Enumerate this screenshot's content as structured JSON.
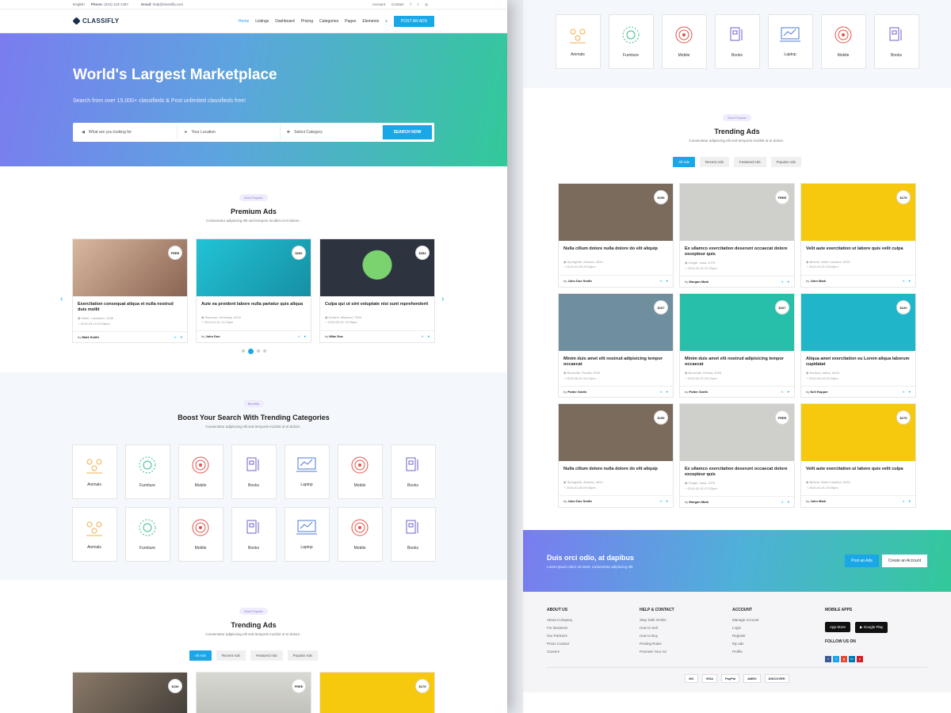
{
  "topbar": {
    "language": "English",
    "phone_label": "Phone:",
    "phone": "(024) 123-1457",
    "email_label": "Email:",
    "email": "help@classifly.com",
    "account": "Account",
    "contact": "Contact"
  },
  "nav": {
    "logo": "CLASSIFLY",
    "items": [
      "Home",
      "Listings",
      "Dashboard",
      "Pricing",
      "Categories",
      "Pages",
      "Elements"
    ],
    "post_button": "POST AN ADS"
  },
  "hero": {
    "title": "World's Largest Marketplace",
    "subtitle": "Search from over 15,000+ classifieds & Post unlimited classifieds free!",
    "search_placeholder": "What are you looking for",
    "location_placeholder": "Your Location",
    "category_select": "Select Category",
    "search_button": "SEARCH NOW"
  },
  "premium": {
    "pill": "Most Popular",
    "title": "Premium Ads",
    "subtitle": "Consectetur adipiscing elit sed tempore incidint ut et dolore .",
    "cards": [
      {
        "price": "FREE",
        "title": "Exercitation consequat aliqua et nulla nostrud duis mollit",
        "location": "Vielle, Louisiana, 1258",
        "date": "2019-05-19 03:08pm",
        "author": "Mark Smith",
        "color": "#b78a72"
      },
      {
        "price": "$292",
        "title": "Aute ea proident labore nulla pariatur quis aliqua",
        "location": "Seymour, Kentucky, 3216",
        "date": "2019-01-01 11:03pm",
        "author": "John Doe",
        "color": "#1fb6c9"
      },
      {
        "price": "$354",
        "title": "Culpa qui ut sint voluptate nisi sunt reprehenderit",
        "location": "Dreamt, Missouri, 7054",
        "date": "2019-02-01 11:09pm",
        "author": "Mike Doe",
        "color": "#46506a"
      }
    ]
  },
  "categories": {
    "pill": "Benefits",
    "title": "Boost Your Search With Trending Categories",
    "subtitle": "Consectetur adipiscing elit sed temporie incidint ut et dolore .",
    "items": [
      "Animals",
      "Furniture",
      "Mobile",
      "Books",
      "Laptop",
      "Mobile",
      "Books"
    ]
  },
  "trending_left": {
    "pill": "Most Popular",
    "title": "Trending Ads",
    "subtitle": "Consectetur adipiscing elit sed temporie incidint ut et dolore .",
    "prices": [
      "$159",
      "FREE",
      "$179"
    ]
  },
  "trending": {
    "pill": "Most Popular",
    "title": "Trending Ads",
    "subtitle": "Consectetur adipiscing elit sed temporie incidint ut et dolore .",
    "tabs": [
      "All Ads",
      "Recent Ads",
      "Featured Ads",
      "Popular Ads"
    ],
    "cards": [
      {
        "price": "$159",
        "title": "Nulla cillum dolore nulla dolore do elit aliquip",
        "location": "Springville, Arizona, 4024",
        "date": "2019-01-06 09:26pm",
        "author": "John Doe Smith",
        "color": "#7b6b5c"
      },
      {
        "price": "FREE",
        "title": "Ex ullamco exercitation deserunt occaecat dolore excepteur quis",
        "location": "Ginger, Iowa, 1076",
        "date": "2019-02-01 07:22pm",
        "author": "Morgan Mark",
        "color": "#cfcfcb"
      },
      {
        "price": "$179",
        "title": "Velit aute exercitation ut labore quis velit culpa",
        "location": "Belvoir, North Carolina, 5102",
        "date": "2019-01-01 03:09pm",
        "author": "John Mark",
        "color": "#f6c90e"
      },
      {
        "price": "$167",
        "title": "Minim duis amet elit nostrud adipisicing tempor occaecat",
        "location": "Boonville, Florida, 8784",
        "date": "2019-06-01 04:21pm",
        "author": "Potter Smith",
        "color": "#6f8f9e"
      },
      {
        "price": "$167",
        "title": "Minim duis amet elit nostrud adipisicing tempor occaecat",
        "location": "Boonville, Florida, 8784",
        "date": "2019-03-21 04:21pm",
        "author": "Potter Smith",
        "color": "#27bfa9"
      },
      {
        "price": "$120",
        "title": "Aliqua amet exercitation eu Lorem aliqua laborum cupidatat",
        "location": "Sanford, Idaho, 6416",
        "date": "2019-04-04 02:20pm",
        "author": "Nell Hopper",
        "color": "#1fb6c9"
      },
      {
        "price": "$159",
        "title": "Nulla cillum dolore nulla dolore do elit aliquip",
        "location": "Springville, Arizona, 4024",
        "date": "2019-01-06 09:26pm",
        "author": "John Doe Smith",
        "color": "#7b6b5c"
      },
      {
        "price": "FREE",
        "title": "Ex ullamco exercitation deserunt occaecat dolore excepteur quis",
        "location": "Ginger, Iowa, 1076",
        "date": "2019-02-01 07:22pm",
        "author": "Morgan Mark",
        "color": "#cfcfcb"
      },
      {
        "price": "$179",
        "title": "Velit aute exercitation ut labore quis velit culpa",
        "location": "Belvoir, North Carolina, 5102",
        "date": "2019-01-01 03:09pm",
        "author": "John Mark",
        "color": "#f6c90e"
      }
    ]
  },
  "cta": {
    "title": "Duis orci odio, at dapibus",
    "subtitle": "Lorem ipsum dolor sit amet, consectetur adipiscing elit.",
    "post_button": "Post an Ads",
    "account_button": "Create an Account"
  },
  "footer": {
    "about": {
      "title": "ABOUT US",
      "links": [
        "About Company",
        "For Business",
        "Our Partners",
        "Press Contact",
        "Careers"
      ]
    },
    "help": {
      "title": "HELP & CONTACT",
      "links": [
        "Stay Safe Online",
        "How to Sell",
        "How to Buy",
        "Posting Rules",
        "Promote Your Ad"
      ]
    },
    "account": {
      "title": "ACCOUNT",
      "links": [
        "Manage Account",
        "Login",
        "Register",
        "My ads",
        "Profile"
      ]
    },
    "apps": {
      "title": "MOBILE APPS",
      "app_store": "App Store",
      "google_play": "Google Play",
      "follow": "FOLLOW US ON"
    },
    "payments": [
      "MC",
      "VISA",
      "PayPal",
      "AMEX",
      "DISCOVER"
    ]
  },
  "colors": {
    "accent": "#19a7e8",
    "gradient_start": "#7a7cf0",
    "gradient_end": "#32c99a"
  }
}
